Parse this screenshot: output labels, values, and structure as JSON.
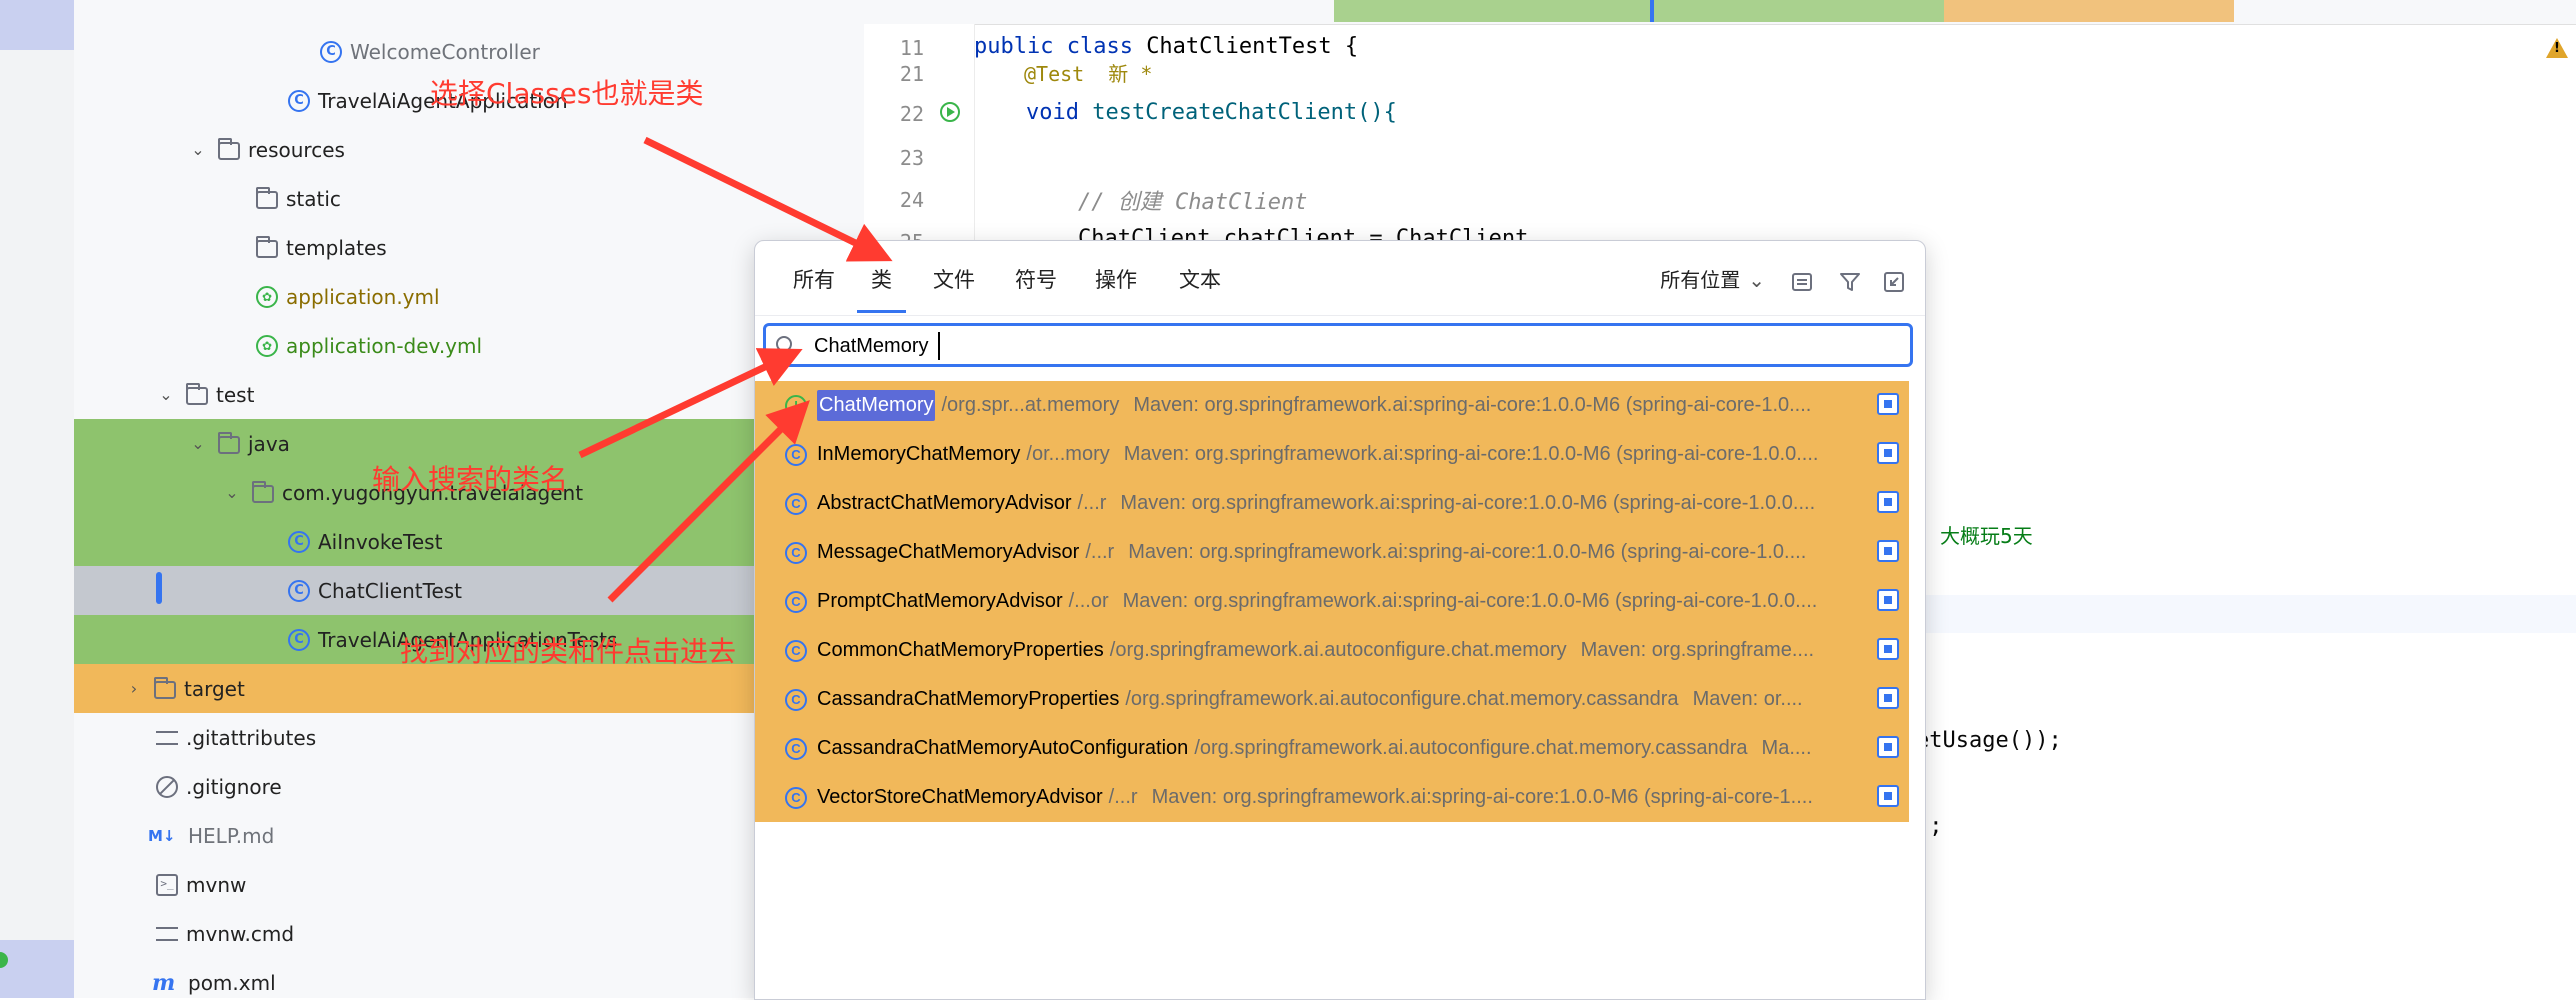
{
  "tree": {
    "items": [
      {
        "label": "WelcomeController",
        "icon": "class-icon"
      },
      {
        "label": "TravelAiAgentApplication",
        "icon": "spring-boot-class-icon"
      },
      {
        "label": "resources",
        "icon": "resources-folder-icon"
      },
      {
        "label": "static",
        "icon": "folder-icon"
      },
      {
        "label": "templates",
        "icon": "folder-icon"
      },
      {
        "label": "application.yml",
        "icon": "spring-config-icon"
      },
      {
        "label": "application-dev.yml",
        "icon": "spring-config-icon"
      },
      {
        "label": "test",
        "icon": "folder-icon"
      },
      {
        "label": "java",
        "icon": "folder-icon"
      },
      {
        "label": "com.yugongyun.travelaiagent",
        "icon": "package-icon"
      },
      {
        "label": "AiInvokeTest",
        "icon": "test-class-icon"
      },
      {
        "label": "ChatClientTest",
        "icon": "test-class-icon"
      },
      {
        "label": "TravelAiAgentApplicationTests",
        "icon": "test-class-icon"
      },
      {
        "label": "target",
        "icon": "folder-icon"
      },
      {
        "label": ".gitattributes",
        "icon": "text-file-icon"
      },
      {
        "label": ".gitignore",
        "icon": "gitignore-icon"
      },
      {
        "label": "HELP.md",
        "icon": "markdown-icon",
        "prefix": "M↓"
      },
      {
        "label": "mvnw",
        "icon": "terminal-icon"
      },
      {
        "label": "mvnw.cmd",
        "icon": "text-file-icon"
      },
      {
        "label": "pom.xml",
        "icon": "maven-icon",
        "prefix": "m"
      }
    ]
  },
  "editor": {
    "lines": [
      {
        "num": "11",
        "code_kw": "public class ",
        "code_rest": "ChatClientTest {"
      },
      {
        "num": "21",
        "code_kw": "",
        "code_rest": "@Test  新 *"
      },
      {
        "num": "22",
        "code_kw": "void ",
        "code_rest": "testCreateChatClient(){"
      },
      {
        "num": "23",
        "code_kw": "",
        "code_rest": ""
      },
      {
        "num": "24",
        "code_kw": "",
        "code_rest": "// 创建 ChatClient"
      },
      {
        "num": "25",
        "code_kw": "",
        "code_rest": "ChatClient chatClient = ChatClient"
      }
    ],
    "fragment_comment": "大概玩5天",
    "fragment_usage": "etUsage());",
    "fragment_end": ");"
  },
  "popup": {
    "tabs": [
      "所有",
      "类",
      "文件",
      "符号",
      "操作",
      "文本"
    ],
    "active_tab": "类",
    "scope_label": "所有位置",
    "search_value": "ChatMemory",
    "results": [
      {
        "icon": "I",
        "kind": "interface",
        "name": "ChatMemory",
        "pkg": "/org.spr...at.memory",
        "maven": "Maven: org.springframework.ai:spring-ai-core:1.0.0-M6 (spring-ai-core-1.0...."
      },
      {
        "icon": "C",
        "kind": "class",
        "name": "InMemoryChatMemory",
        "pkg": "/or...mory",
        "maven": "Maven: org.springframework.ai:spring-ai-core:1.0.0-M6 (spring-ai-core-1.0.0...."
      },
      {
        "icon": "C",
        "kind": "abstract-class",
        "name": "AbstractChatMemoryAdvisor",
        "pkg": "/...r",
        "maven": "Maven: org.springframework.ai:spring-ai-core:1.0.0-M6 (spring-ai-core-1.0.0...."
      },
      {
        "icon": "C",
        "kind": "class",
        "name": "MessageChatMemoryAdvisor",
        "pkg": "/...r",
        "maven": "Maven: org.springframework.ai:spring-ai-core:1.0.0-M6 (spring-ai-core-1.0...."
      },
      {
        "icon": "C",
        "kind": "class",
        "name": "PromptChatMemoryAdvisor",
        "pkg": "/...or",
        "maven": "Maven: org.springframework.ai:spring-ai-core:1.0.0-M6 (spring-ai-core-1.0.0...."
      },
      {
        "icon": "C",
        "kind": "class",
        "name": "CommonChatMemoryProperties",
        "pkg": "/org.springframework.ai.autoconfigure.chat.memory",
        "maven": "Maven: org.springframe...."
      },
      {
        "icon": "C",
        "kind": "class",
        "name": "CassandraChatMemoryProperties",
        "pkg": "/org.springframework.ai.autoconfigure.chat.memory.cassandra",
        "maven": "Maven: or...."
      },
      {
        "icon": "C",
        "kind": "class",
        "name": "CassandraChatMemoryAutoConfiguration",
        "pkg": "/org.springframework.ai.autoconfigure.chat.memory.cassandra",
        "maven": "Ma...."
      },
      {
        "icon": "C",
        "kind": "class",
        "name": "VectorStoreChatMemoryAdvisor",
        "pkg": "/...r",
        "maven": "Maven: org.springframework.ai:spring-ai-core:1.0.0-M6 (spring-ai-core-1...."
      }
    ]
  },
  "annotations": {
    "choose_classes": "选择Classes也就是类",
    "input_class_name": "输入搜索的类名",
    "find_and_click": "找到对应的类和件点击进去"
  },
  "colors": {
    "accent": "#3574f0",
    "annotation": "#ff3b30",
    "highlight_green": "#8ec36d",
    "highlight_orange": "#f1b85a",
    "match_highlight": "#5c6bd8"
  }
}
